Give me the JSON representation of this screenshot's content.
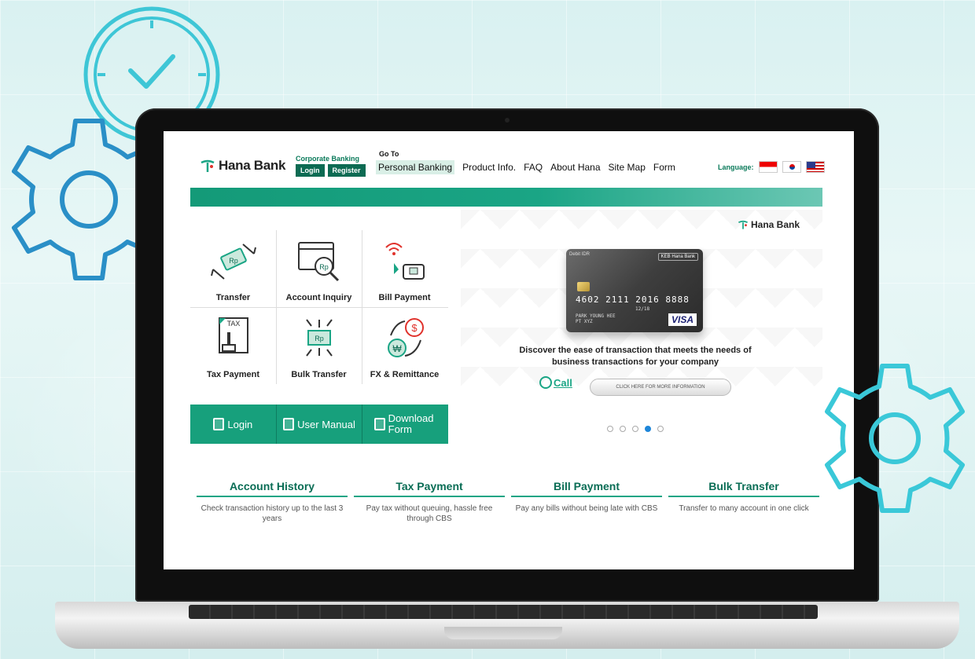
{
  "header": {
    "logo_text": "Hana Bank",
    "corporate_label": "Corporate Banking",
    "login_label": "Login",
    "register_label": "Register",
    "goto_label": "Go To",
    "nav": [
      "Personal Banking",
      "Product Info.",
      "FAQ",
      "About Hana",
      "Site Map",
      "Form"
    ],
    "language_label": "Language:",
    "languages": [
      "id-flag",
      "kr-flag",
      "us-flag"
    ]
  },
  "services": [
    {
      "label": "Transfer",
      "icon": "transfer-icon"
    },
    {
      "label": "Account Inquiry",
      "icon": "account-inquiry-icon"
    },
    {
      "label": "Bill Payment",
      "icon": "bill-payment-icon"
    },
    {
      "label": "Tax Payment",
      "icon": "tax-payment-icon"
    },
    {
      "label": "Bulk Transfer",
      "icon": "bulk-transfer-icon"
    },
    {
      "label": "FX & Remittance",
      "icon": "fx-remittance-icon"
    }
  ],
  "actions": {
    "login": "Login",
    "user_manual": "User Manual",
    "download_form": "Download Form"
  },
  "banner": {
    "brand": "Hana Bank",
    "card_top": "Debit IDR",
    "card_brand": "KEB Hana Bank",
    "card_number": "4602 2111 2016 8888",
    "card_expiry": "12/18",
    "card_name_1": "PARK YOUNG HEE",
    "card_name_2": "PT XYZ",
    "card_network": "VISA",
    "tagline": "Discover the ease of transaction that meets the needs of business transactions for your company",
    "call_label": "Call",
    "click_label": "CLICK HERE FOR MORE INFORMATION",
    "slides": 5,
    "active_slide": 4
  },
  "features": [
    {
      "title": "Account History",
      "desc": "Check transaction history up to the last 3 years"
    },
    {
      "title": "Tax Payment",
      "desc": "Pay tax without queuing, hassle free through CBS"
    },
    {
      "title": "Bill Payment",
      "desc": "Pay any bills without being late with CBS"
    },
    {
      "title": "Bulk Transfer",
      "desc": "Transfer to many account in one click"
    }
  ],
  "colors": {
    "brand_green": "#1aa585",
    "dark_green": "#0d6b53",
    "gear_blue": "#2a8fc7",
    "gear_cyan": "#3ac8d8"
  }
}
